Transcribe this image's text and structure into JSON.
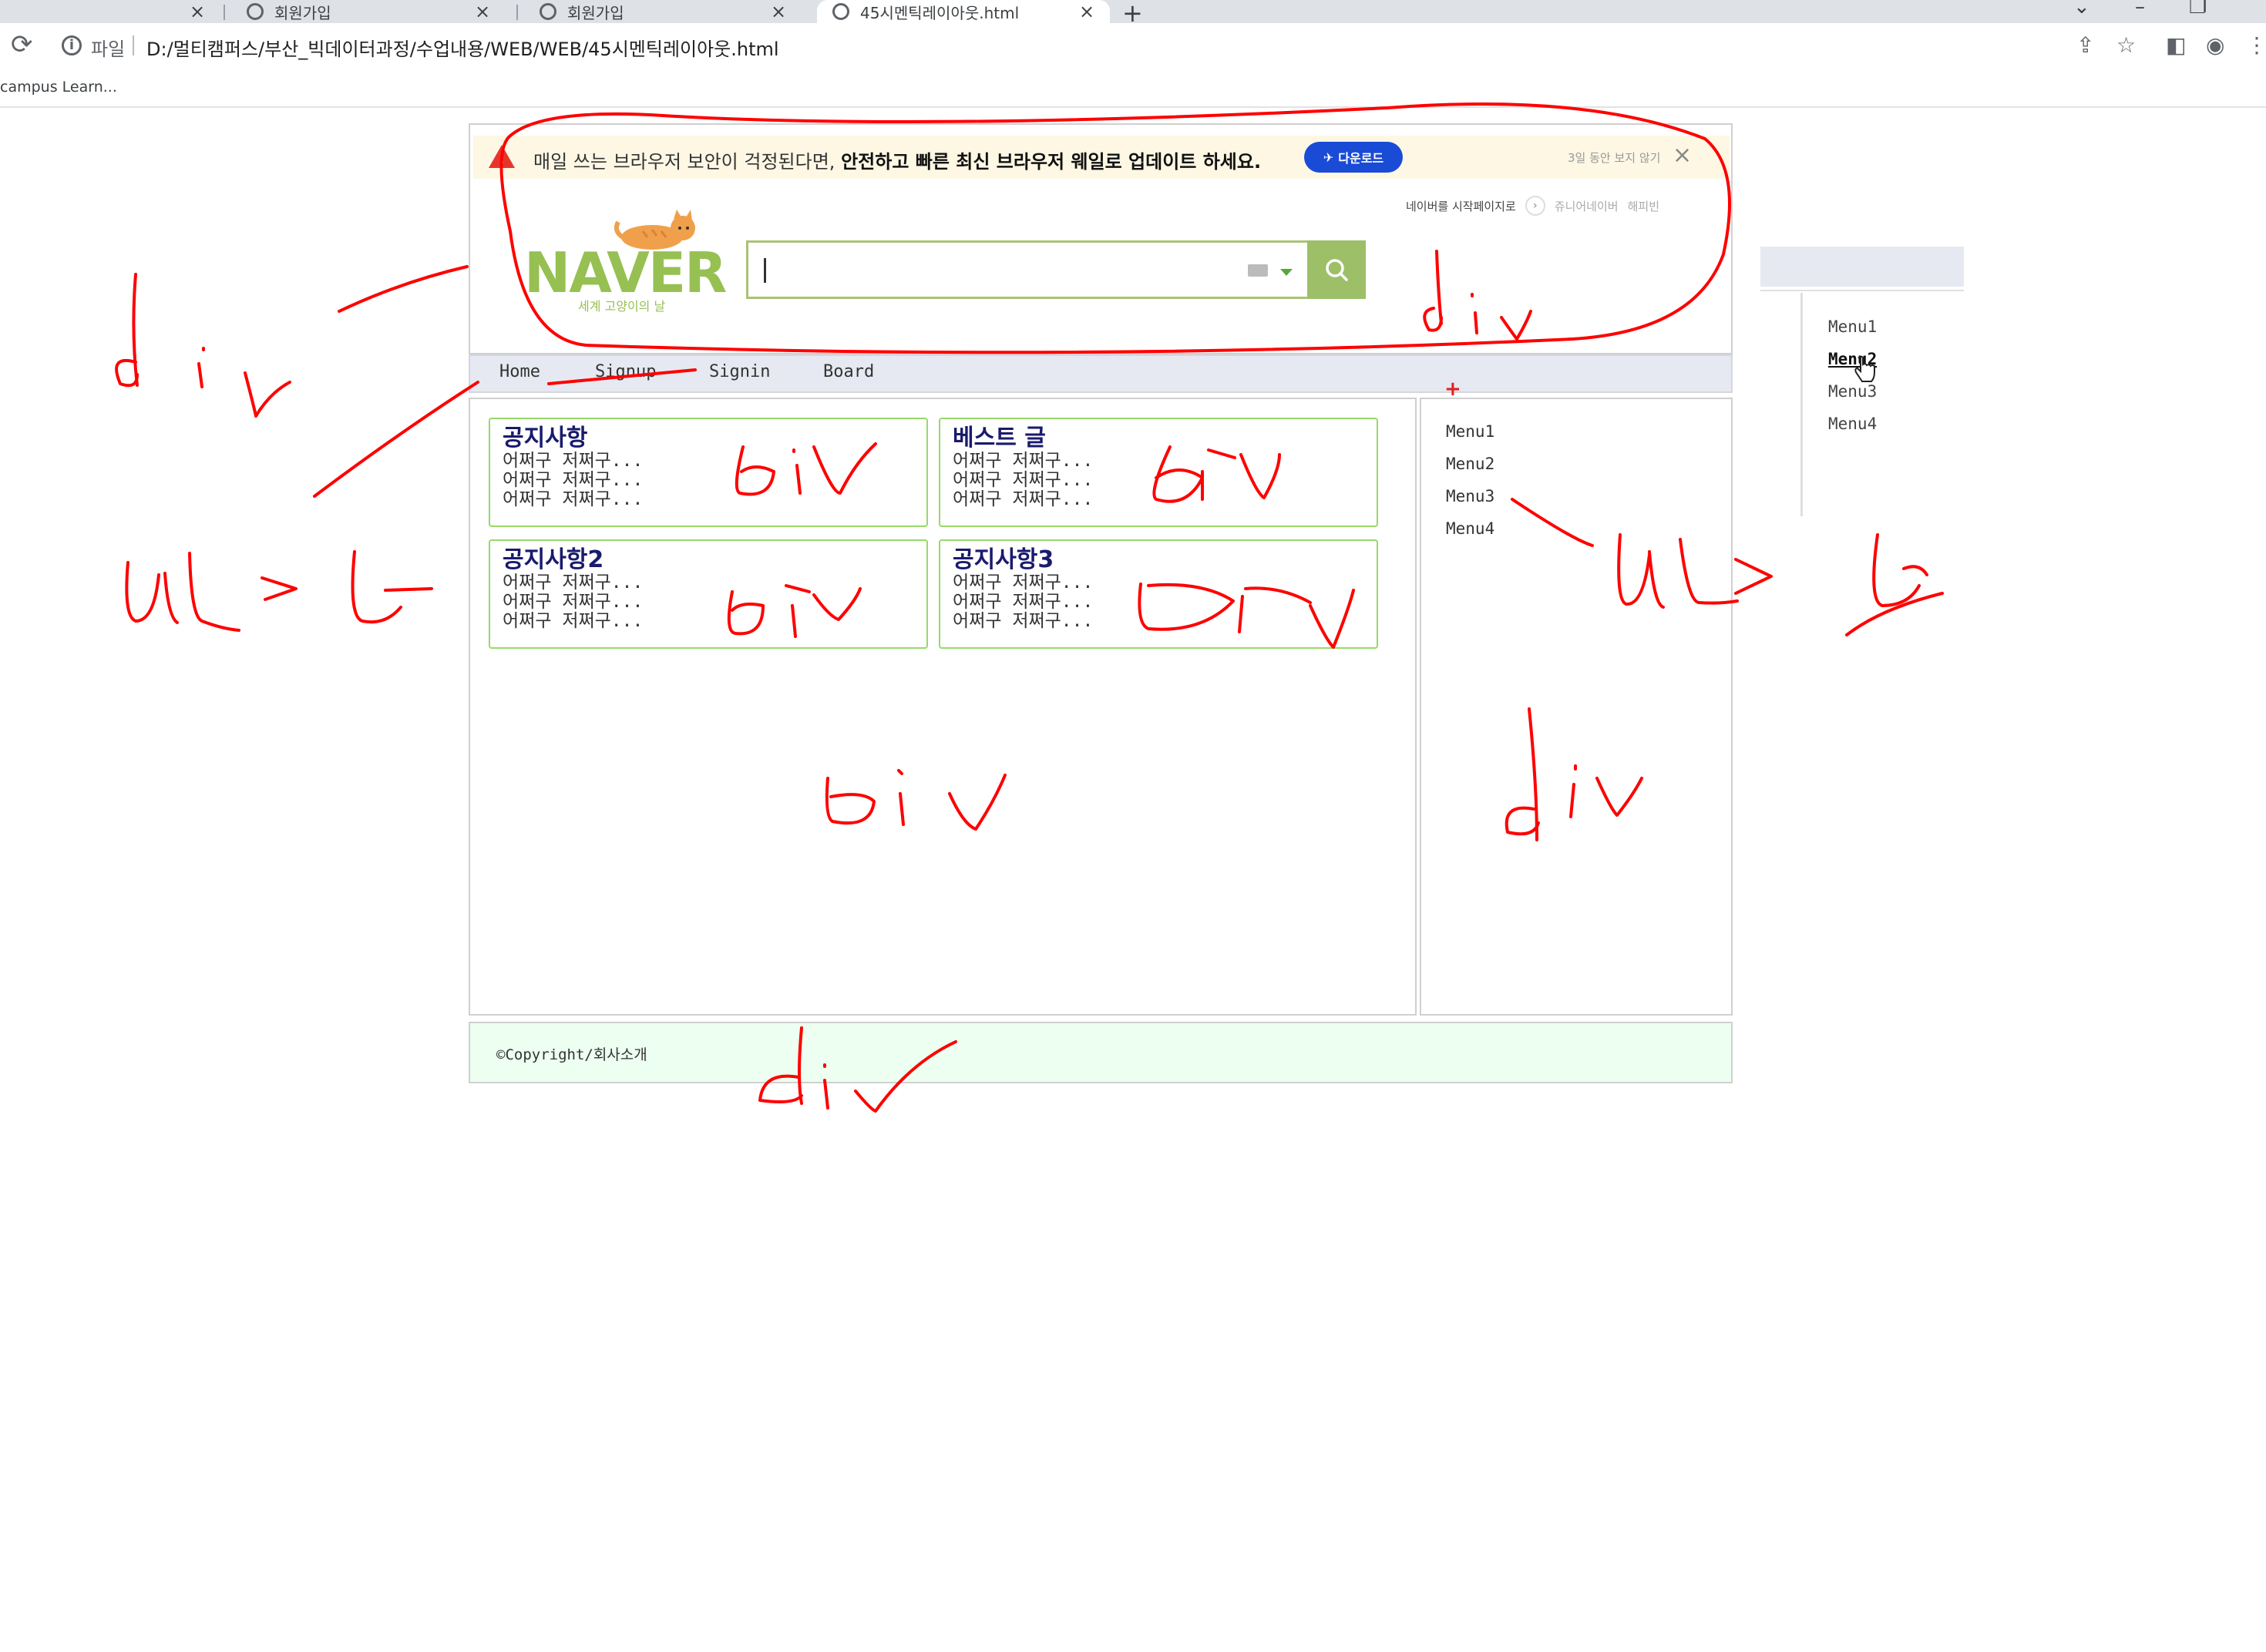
{
  "browser": {
    "tabs": [
      {
        "title": "회원가입"
      },
      {
        "title": "회원가입"
      },
      {
        "title": "45시멘틱레이아웃.html",
        "active": true
      }
    ],
    "address": {
      "scheme": "파일",
      "url": "D:/멀티캠퍼스/부산_빅데이터과정/수업내용/WEB/WEB/45시멘틱레이아웃.html"
    },
    "bookmark": "campus Learn..."
  },
  "header": {
    "banner_text": "매일 쓰는 브라우저 보안이 걱정된다면,",
    "banner_bold": "안전하고 빠른 최신 브라우저 웨일로 업데이트 하세요.",
    "download_label": "다운로드",
    "hide_label": "3일 동안 보지 않기",
    "start_page_label": "네이버를 시작페이지로",
    "link_1": "쥬니어네이버",
    "link_2": "해피빈",
    "logo": "NAVER",
    "logo_sub": "세계 고양이의 날",
    "search_value": ""
  },
  "nav": {
    "items": [
      "Home",
      "Signup",
      "Signin",
      "Board"
    ]
  },
  "main": {
    "cards": [
      {
        "title": "공지사항",
        "lines": [
          "어쩌구 저쩌구...",
          "어쩌구 저쩌구...",
          "어쩌구 저쩌구..."
        ]
      },
      {
        "title": "베스트 글",
        "lines": [
          "어쩌구 저쩌구...",
          "어쩌구 저쩌구...",
          "어쩌구 저쩌구..."
        ]
      },
      {
        "title": "공지사항2",
        "lines": [
          "어쩌구 저쩌구...",
          "어쩌구 저쩌구...",
          "어쩌구 저쩌구..."
        ]
      },
      {
        "title": "공지사항3",
        "lines": [
          "어쩌구 저쩌구...",
          "어쩌구 저쩌구...",
          "어쩌구 저쩌구..."
        ]
      }
    ]
  },
  "aside": {
    "items": [
      "Menu1",
      "Menu2",
      "Menu3",
      "Menu4"
    ]
  },
  "second_menu": {
    "items": [
      "Menu1",
      "Menu2",
      "Menu3",
      "Menu4"
    ],
    "hovered": "Menu2"
  },
  "footer": {
    "text": "©Copyright/회사소개"
  },
  "colors": {
    "accent_green": "#97c052",
    "card_border": "#97d967",
    "nav_bg": "#e6e9f1",
    "footer_bg": "#ecfff0",
    "annotation": "#ff0000"
  }
}
